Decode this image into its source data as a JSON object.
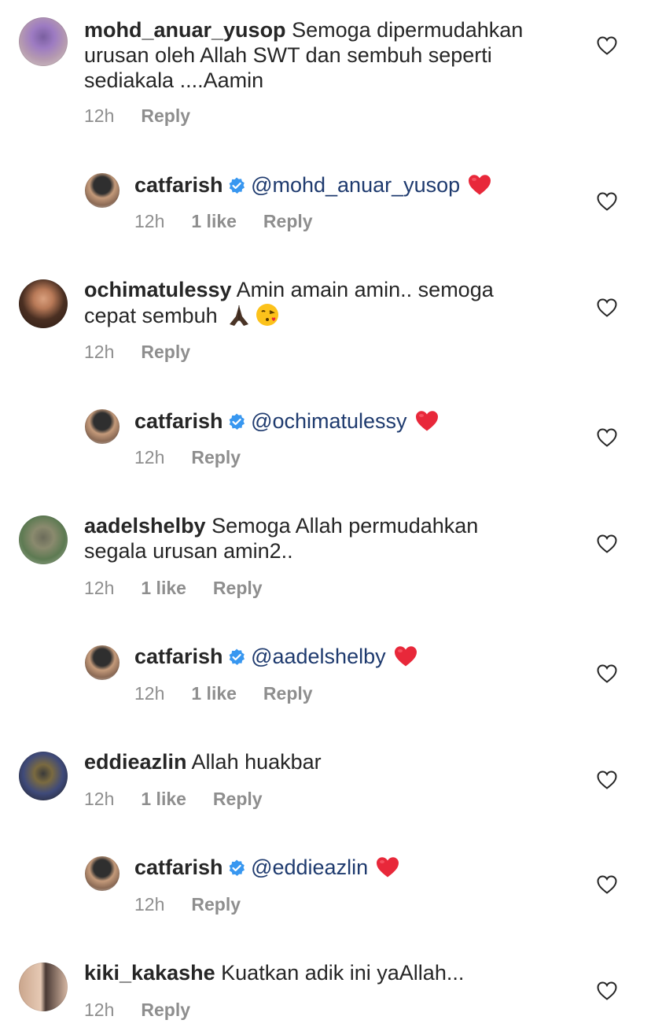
{
  "comments": [
    {
      "user": "mohd_anuar_yusop",
      "text": "Semoga dipermudahkan",
      "text2": "urusan oleh Allah SWT dan sembuh seperti",
      "text3": "sediakala ....Aamin",
      "time": "12h",
      "reply": "Reply"
    },
    {
      "user": "catfarish",
      "mention": "@mohd_anuar_yusop",
      "time": "12h",
      "likes": "1 like",
      "reply": "Reply"
    },
    {
      "user": "ochimatulessy",
      "text": "Amin amain amin.. semoga",
      "text2": "cepat sembuh",
      "time": "12h",
      "reply": "Reply"
    },
    {
      "user": "catfarish",
      "mention": "@ochimatulessy",
      "time": "12h",
      "reply": "Reply"
    },
    {
      "user": "aadelshelby",
      "text": "Semoga Allah permudahkan",
      "text2": "segala urusan amin2..",
      "time": "12h",
      "likes": "1 like",
      "reply": "Reply"
    },
    {
      "user": "catfarish",
      "mention": "@aadelshelby",
      "time": "12h",
      "likes": "1 like",
      "reply": "Reply"
    },
    {
      "user": "eddieazlin",
      "text": "Allah huakbar",
      "time": "12h",
      "likes": "1 like",
      "reply": "Reply"
    },
    {
      "user": "catfarish",
      "mention": "@eddieazlin",
      "time": "12h",
      "reply": "Reply"
    },
    {
      "user": "kiki_kakashe",
      "text": "Kuatkan adik ini yaAllah...",
      "time": "12h",
      "reply": "Reply"
    }
  ],
  "colors": {
    "text": "#262626",
    "meta": "#8e8e8e",
    "mention": "#1e3a6e",
    "verified": "#3897f0",
    "heart": "#ed4956"
  }
}
